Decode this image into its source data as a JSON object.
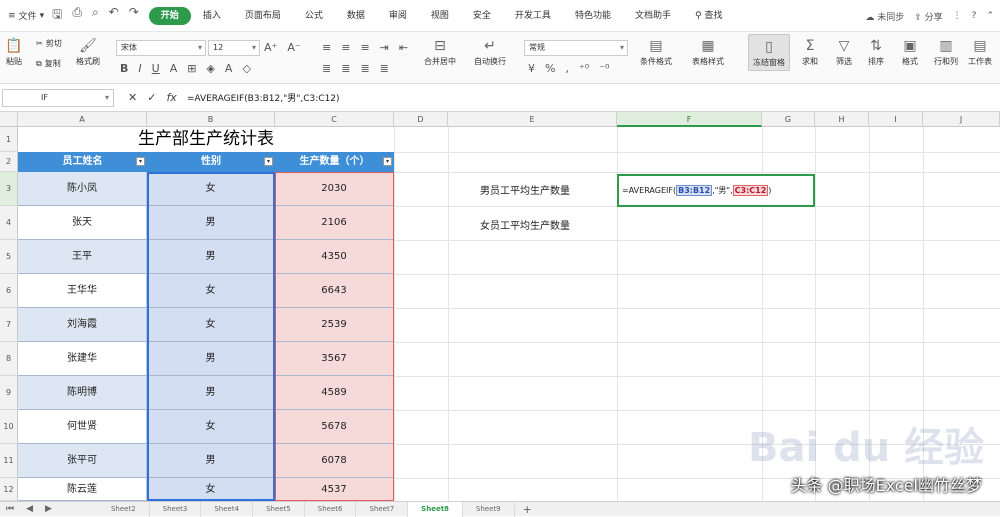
{
  "menu": {
    "file_label": "文件",
    "tabs": [
      "开始",
      "插入",
      "页面布局",
      "公式",
      "数据",
      "审阅",
      "视图",
      "安全",
      "开发工具",
      "特色功能",
      "文档助手"
    ],
    "active_tab": "开始",
    "search_label": "查找",
    "right": {
      "sync": "未同步",
      "share": "分享"
    }
  },
  "ribbon": {
    "cut": "剪切",
    "copy": "复制",
    "format_painter": "格式刷",
    "paste": "粘贴",
    "font": "宋体",
    "font_size": "12",
    "merge": "合并居中",
    "wrap": "自动换行",
    "number_format": "常规",
    "cond_format": "条件格式",
    "table_style": "表格样式",
    "freeze": "冻结窗格",
    "sum": "求和",
    "filter": "筛选",
    "sort": "排序",
    "format": "格式",
    "rowcol": "行和列",
    "sheet": "工作表"
  },
  "formula_bar": {
    "name_box": "IF",
    "fx": "fx",
    "formula": "=AVERAGEIF(B3:B12,\"男\",C3:C12)"
  },
  "columns": [
    "A",
    "B",
    "C",
    "D",
    "E",
    "F",
    "G",
    "H",
    "I",
    "J"
  ],
  "active_column": "F",
  "rows": [
    "1",
    "2",
    "3",
    "4",
    "5",
    "6",
    "7",
    "8",
    "9",
    "10",
    "11",
    "12"
  ],
  "table": {
    "title": "生产部生产统计表",
    "headers": [
      "员工姓名",
      "性别",
      "生产数量（个）"
    ],
    "data": [
      [
        "陈小凤",
        "女",
        "2030"
      ],
      [
        "张天",
        "男",
        "2106"
      ],
      [
        "王平",
        "男",
        "4350"
      ],
      [
        "王华华",
        "女",
        "6643"
      ],
      [
        "刘海霞",
        "女",
        "2539"
      ],
      [
        "张建华",
        "男",
        "3567"
      ],
      [
        "陈明博",
        "男",
        "4589"
      ],
      [
        "何世贤",
        "女",
        "5678"
      ],
      [
        "张平可",
        "男",
        "6078"
      ],
      [
        "陈云莲",
        "女",
        "4537"
      ]
    ]
  },
  "labels": {
    "male_avg": "男员工平均生产数量",
    "female_avg": "女员工平均生产数量"
  },
  "edit": {
    "prefix": "=AVERAGEIF(",
    "range": "B3:B12",
    "mid": ",\"男\",",
    "range2": "C3:C12",
    "suffix": ")"
  },
  "sheets": [
    "Sheet2",
    "Sheet3",
    "Sheet4",
    "Sheet5",
    "Sheet6",
    "Sheet7",
    "Sheet8",
    "Sheet9"
  ],
  "active_sheet": "Sheet8",
  "watermark": "头条 @职场Excel幽竹丝梦",
  "colors": {
    "accent": "#2e9a4b",
    "header_blue": "#3f8ed8",
    "header_red": "#e05a5a"
  }
}
